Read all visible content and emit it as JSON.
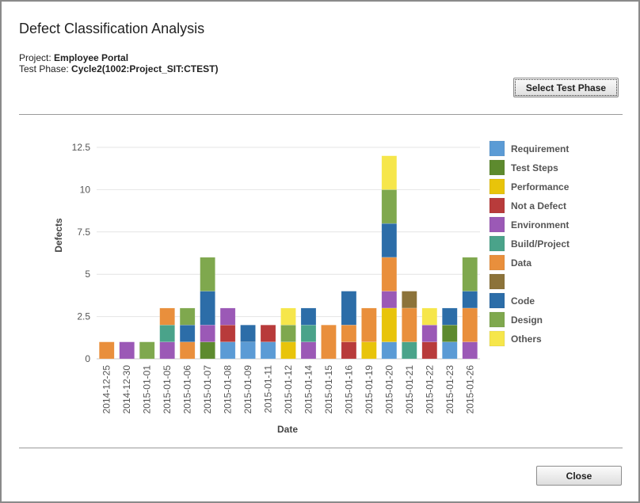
{
  "dialog": {
    "title": "Defect Classification Analysis",
    "project_label": "Project:",
    "project_value": "Employee Portal",
    "phase_label": "Test Phase:",
    "phase_value": "Cycle2(1002:Project_SIT:CTEST)",
    "select_phase_button": "Select Test Phase",
    "close_button": "Close"
  },
  "chart_data": {
    "type": "bar",
    "stacked": true,
    "xlabel": "Date",
    "ylabel": "Defects",
    "ylim": [
      0,
      12.5
    ],
    "yticks": [
      0,
      2.5,
      5,
      7.5,
      10,
      12.5
    ],
    "grid": true,
    "legend_position": "right",
    "categories": [
      "2014-12-25",
      "2014-12-30",
      "2015-01-01",
      "2015-01-05",
      "2015-01-06",
      "2015-01-07",
      "2015-01-08",
      "2015-01-09",
      "2015-01-11",
      "2015-01-12",
      "2015-01-14",
      "2015-01-15",
      "2015-01-16",
      "2015-01-19",
      "2015-01-20",
      "2015-01-21",
      "2015-01-22",
      "2015-01-23",
      "2015-01-26"
    ],
    "series": [
      {
        "name": "Requirement",
        "color": "#5b9bd5",
        "values": [
          0,
          0,
          0,
          0,
          0,
          0,
          1,
          1,
          1,
          0,
          0,
          0,
          0,
          0,
          1,
          0,
          0,
          1,
          0
        ]
      },
      {
        "name": "Test Steps",
        "color": "#5d8a2e",
        "values": [
          0,
          0,
          0,
          0,
          0,
          1,
          0,
          0,
          0,
          0,
          0,
          0,
          0,
          0,
          0,
          0,
          0,
          1,
          0
        ]
      },
      {
        "name": "Performance",
        "color": "#e8c40a",
        "values": [
          0,
          0,
          0,
          0,
          0,
          0,
          0,
          0,
          0,
          1,
          0,
          0,
          0,
          1,
          2,
          0,
          0,
          0,
          0
        ]
      },
      {
        "name": "Not a Defect",
        "color": "#b83b3b",
        "values": [
          0,
          0,
          0,
          0,
          0,
          0,
          1,
          0,
          1,
          0,
          0,
          0,
          1,
          0,
          0,
          0,
          1,
          0,
          0
        ]
      },
      {
        "name": "Environment",
        "color": "#9b59b6",
        "values": [
          0,
          1,
          0,
          1,
          0,
          1,
          1,
          0,
          0,
          0,
          1,
          0,
          0,
          0,
          1,
          0,
          1,
          0,
          1
        ]
      },
      {
        "name": "Build/Project",
        "color": "#4aa38a",
        "values": [
          0,
          0,
          0,
          1,
          0,
          0,
          0,
          0,
          0,
          0,
          1,
          0,
          0,
          0,
          0,
          1,
          0,
          0,
          0
        ]
      },
      {
        "name": "Data",
        "color": "#e98f3c",
        "values": [
          1,
          0,
          0,
          1,
          1,
          0,
          0,
          0,
          0,
          0,
          0,
          2,
          1,
          2,
          2,
          2,
          0,
          0,
          2
        ]
      },
      {
        "name": "",
        "color": "#8c733a",
        "values": [
          0,
          0,
          0,
          0,
          0,
          0,
          0,
          0,
          0,
          0,
          0,
          0,
          0,
          0,
          0,
          1,
          0,
          0,
          0
        ]
      },
      {
        "name": "Code",
        "color": "#2c6da8",
        "values": [
          0,
          0,
          0,
          0,
          1,
          2,
          0,
          1,
          0,
          0,
          1,
          0,
          2,
          0,
          2,
          0,
          0,
          1,
          1
        ]
      },
      {
        "name": "Design",
        "color": "#7fa84e",
        "values": [
          0,
          0,
          1,
          0,
          1,
          2,
          0,
          0,
          0,
          1,
          0,
          0,
          0,
          0,
          2,
          0,
          0,
          0,
          2
        ]
      },
      {
        "name": "Others",
        "color": "#f6e64b",
        "values": [
          0,
          0,
          0,
          0,
          0,
          0,
          0,
          0,
          0,
          1,
          0,
          0,
          0,
          0,
          2,
          0,
          1,
          0,
          0
        ]
      }
    ]
  }
}
